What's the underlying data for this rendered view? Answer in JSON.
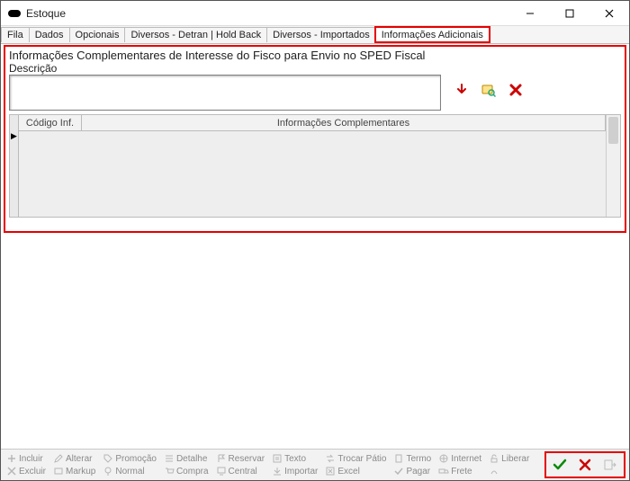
{
  "window": {
    "title": "Estoque"
  },
  "tabs": [
    {
      "label": "Fila"
    },
    {
      "label": "Dados"
    },
    {
      "label": "Opcionais"
    },
    {
      "label": "Diversos - Detran | Hold Back"
    },
    {
      "label": "Diversos - Importados"
    },
    {
      "label": "Informações Adicionais"
    }
  ],
  "active_tab_index": 5,
  "panel": {
    "title": "Informações Complementares de Interesse do Fisco para Envio no SPED Fiscal",
    "description_label": "Descrição",
    "description_value": ""
  },
  "grid": {
    "columns": {
      "code": "Código Inf.",
      "info": "Informações Complementares"
    },
    "rows": []
  },
  "toolbar": {
    "row1": [
      {
        "name": "incluir",
        "label": "Incluir"
      },
      {
        "name": "alterar",
        "label": "Alterar"
      },
      {
        "name": "promocao",
        "label": "Promoção"
      },
      {
        "name": "detalhe",
        "label": "Detalhe"
      },
      {
        "name": "reservar",
        "label": "Reservar"
      },
      {
        "name": "texto",
        "label": "Texto"
      },
      {
        "name": "trocar",
        "label": "Trocar Pátio"
      },
      {
        "name": "termo",
        "label": "Termo"
      },
      {
        "name": "internet",
        "label": "Internet"
      },
      {
        "name": "liberar",
        "label": "Liberar"
      }
    ],
    "row2": [
      {
        "name": "excluir",
        "label": "Excluir"
      },
      {
        "name": "markup",
        "label": "Markup"
      },
      {
        "name": "normal",
        "label": "Normal"
      },
      {
        "name": "compra",
        "label": "Compra"
      },
      {
        "name": "central",
        "label": "Central"
      },
      {
        "name": "importar",
        "label": "Importar"
      },
      {
        "name": "excel",
        "label": "Excel"
      },
      {
        "name": "pagar",
        "label": "Pagar"
      },
      {
        "name": "frete",
        "label": "Frete"
      }
    ]
  }
}
